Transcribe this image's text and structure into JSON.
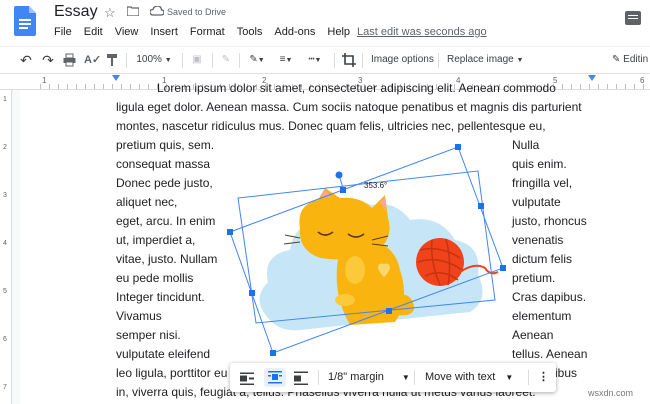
{
  "app": {
    "title": "Essay",
    "saved": "Saved to Drive",
    "last_edit": "Last edit was seconds ago"
  },
  "menu": [
    "File",
    "Edit",
    "View",
    "Insert",
    "Format",
    "Tools",
    "Add-ons",
    "Help"
  ],
  "toolbar": {
    "zoom": "100%",
    "image_options": "Image options",
    "replace_image": "Replace image",
    "editing": "Editin"
  },
  "ruler": {
    "h": [
      "1",
      "1",
      "2",
      "3",
      "4",
      "5",
      "6"
    ],
    "v": [
      "1",
      "2",
      "3",
      "4",
      "5",
      "6",
      "7"
    ]
  },
  "rotation": "353.6°",
  "body": {
    "lines_full": [
      "Lorem ipsum dolor sit amet, consectetuer adipiscing elit. Aenean commodo",
      "ligula eget dolor. Aenean massa. Cum sociis natoque penatibus et magnis dis parturient",
      "montes, nascetur ridiculus mus. Donec quam felis, ultricies nec, pellentesque eu,"
    ],
    "left_col": [
      "pretium quis, sem.",
      "consequat massa",
      "Donec pede justo,",
      "aliquet nec,",
      "eget, arcu. In enim",
      "ut, imperdiet a,",
      "vitae, justo. Nullam",
      "eu pede mollis",
      "Integer tincidunt.",
      "Vivamus",
      "semper nisi.",
      "vulputate eleifend",
      "leo ligula, porttitor eu",
      "in, viverra quis, feugiat a, tellus. Phasellus viverra nulla ut metus varius laoreet."
    ],
    "right_col": [
      "Nulla",
      "quis enim.",
      "fringilla vel,",
      "vulputate",
      "justo, rhoncus",
      "venenatis",
      "dictum felis",
      "pretium.",
      "Cras dapibus.",
      "elementum",
      "Aenean",
      "tellus. Aenean",
      "ibus"
    ]
  },
  "context": {
    "margin": "1/8\" margin",
    "move": "Move with text"
  },
  "watermark": "wsxdn.com",
  "colors": {
    "accent": "#1a73e8",
    "yarn": "#f0421b",
    "cat": "#f9b40f",
    "cloud": "#c6e6f7"
  }
}
